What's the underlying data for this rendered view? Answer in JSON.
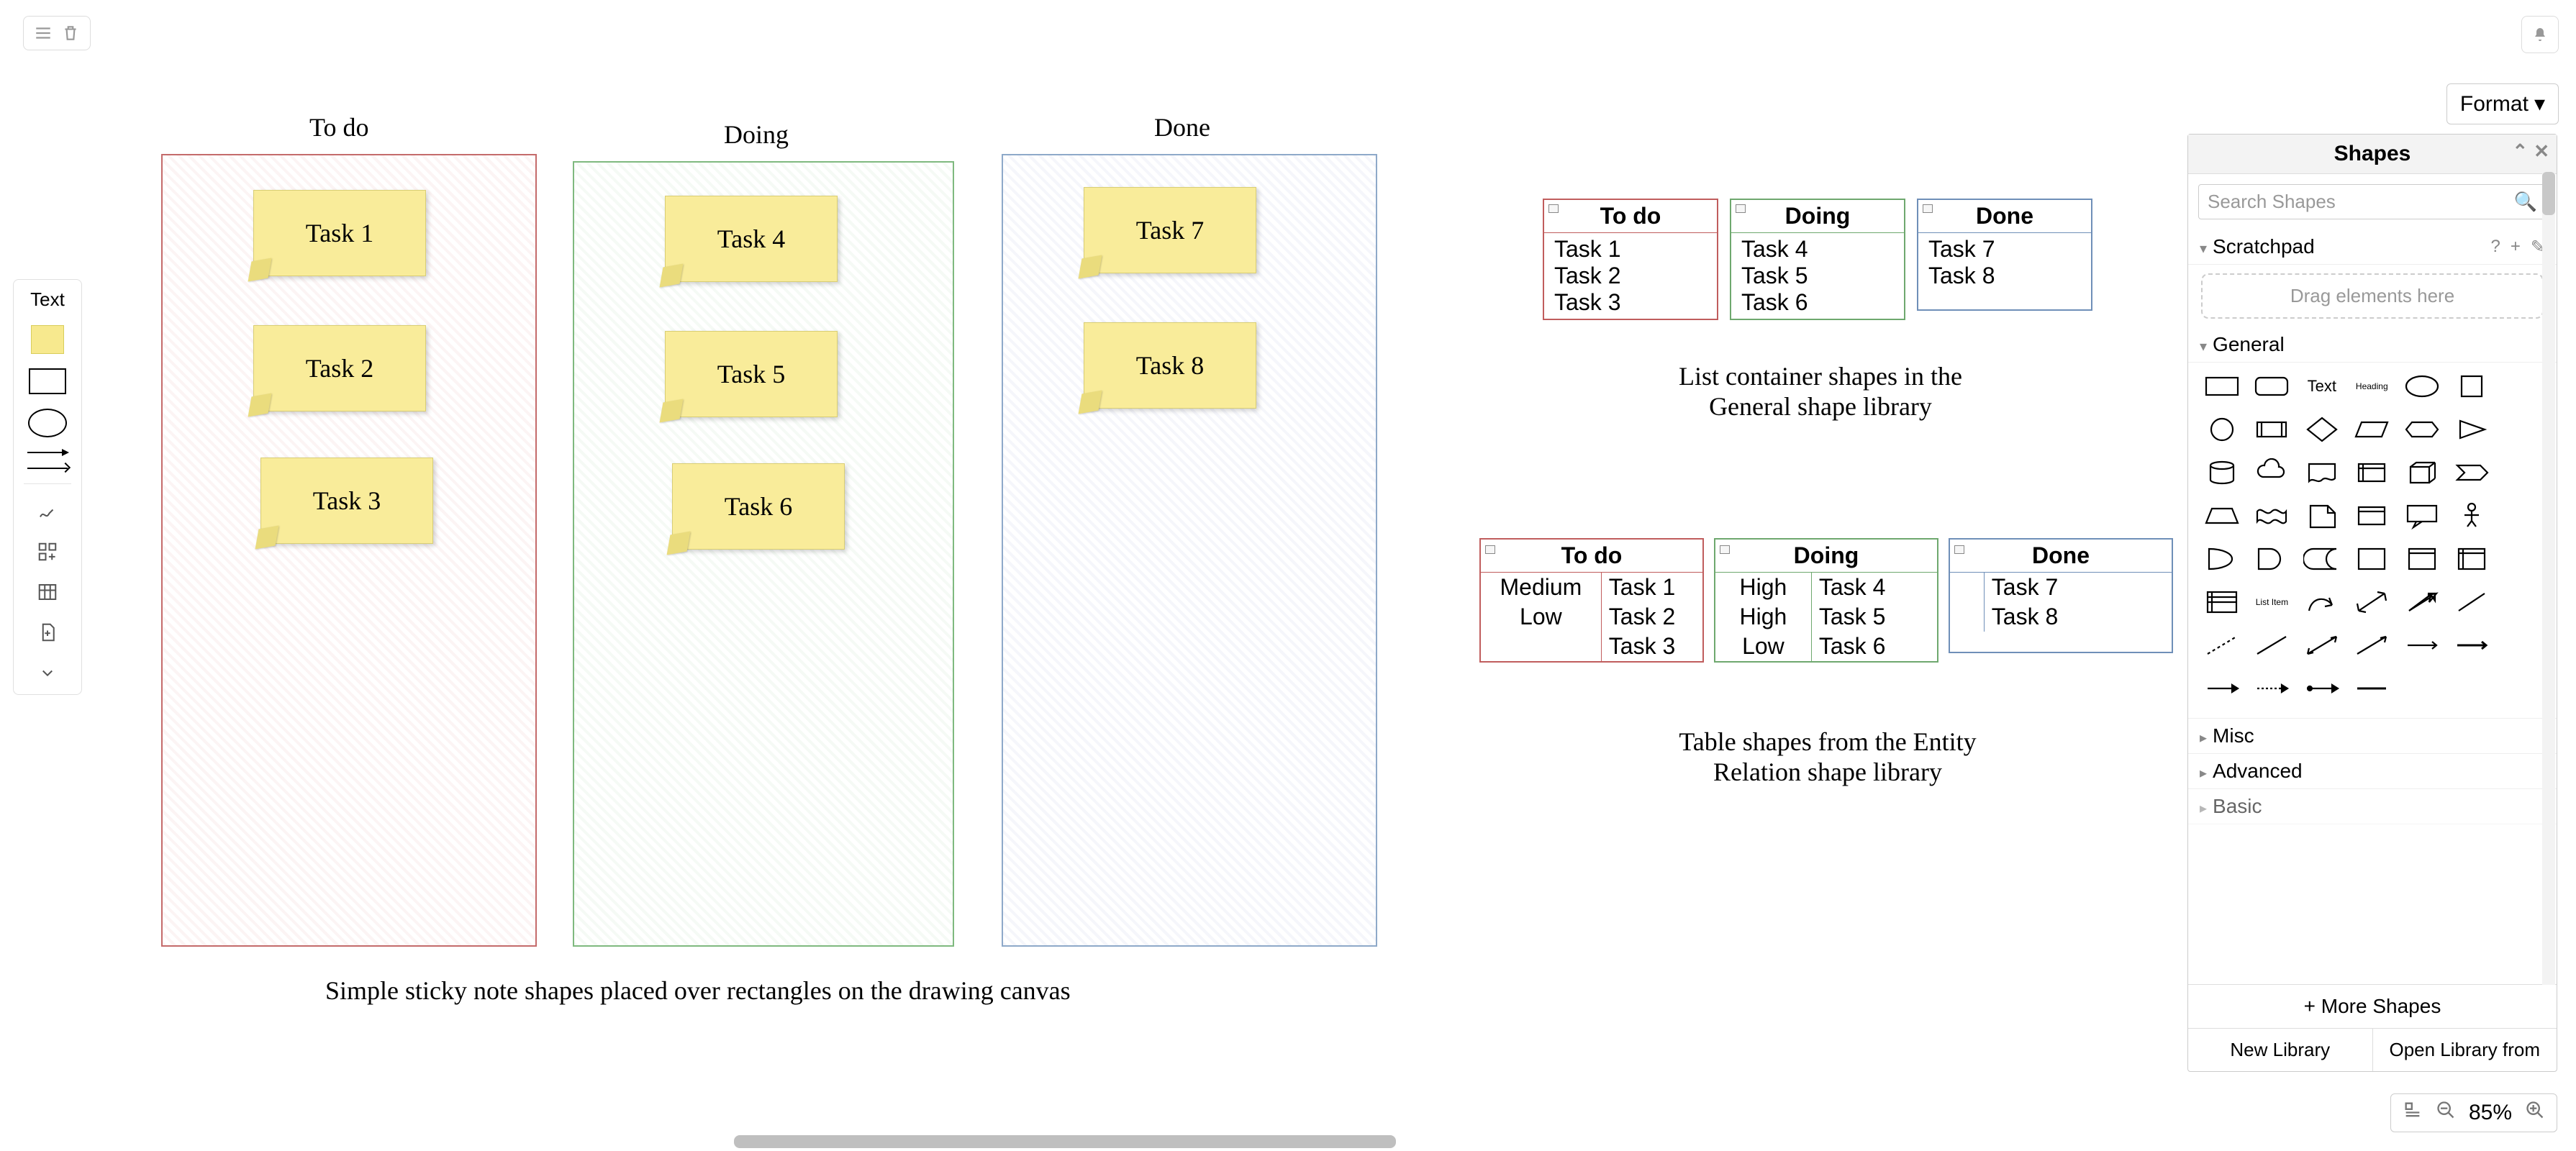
{
  "toolbar": {
    "format_label": "Format"
  },
  "left": {
    "text_label": "Text"
  },
  "kanban": {
    "columns": [
      {
        "title": "To do",
        "tasks": [
          "Task 1",
          "Task 2",
          "Task 3"
        ]
      },
      {
        "title": "Doing",
        "tasks": [
          "Task 4",
          "Task 5",
          "Task 6"
        ]
      },
      {
        "title": "Done",
        "tasks": [
          "Task 7",
          "Task 8"
        ]
      }
    ],
    "caption": "Simple sticky note shapes placed over rectangles on the drawing canvas"
  },
  "lists": {
    "columns": [
      {
        "title": "To do",
        "items": [
          "Task 1",
          "Task 2",
          "Task 3"
        ]
      },
      {
        "title": "Doing",
        "items": [
          "Task 4",
          "Task 5",
          "Task 6"
        ]
      },
      {
        "title": "Done",
        "items": [
          "Task 7",
          "Task 8"
        ]
      }
    ],
    "caption_l1": "List container shapes in the",
    "caption_l2": "General shape library"
  },
  "tables": {
    "columns": [
      {
        "title": "To do",
        "rows": [
          [
            "Medium",
            "Task 1"
          ],
          [
            "Low",
            "Task 2"
          ],
          [
            "",
            "Task 3"
          ]
        ]
      },
      {
        "title": "Doing",
        "rows": [
          [
            "High",
            "Task 4"
          ],
          [
            "High",
            "Task 5"
          ],
          [
            "Low",
            "Task 6"
          ]
        ]
      },
      {
        "title": "Done",
        "rows": [
          [
            "",
            "Task 7"
          ],
          [
            "",
            "Task 8"
          ]
        ]
      }
    ],
    "caption_l1": "Table shapes from the Entity",
    "caption_l2": "Relation shape library"
  },
  "panel": {
    "title": "Shapes",
    "search_placeholder": "Search Shapes",
    "scratchpad_label": "Scratchpad",
    "dropzone_label": "Drag elements here",
    "general_label": "General",
    "misc_label": "Misc",
    "advanced_label": "Advanced",
    "basic_label": "Basic",
    "text_glyph": "Text",
    "heading_glyph": "Heading",
    "listitem_glyph": "List Item",
    "more_shapes_label": "+ More Shapes",
    "new_library_label": "New Library",
    "open_library_label": "Open Library from"
  },
  "zoom": {
    "percent": "85%"
  }
}
